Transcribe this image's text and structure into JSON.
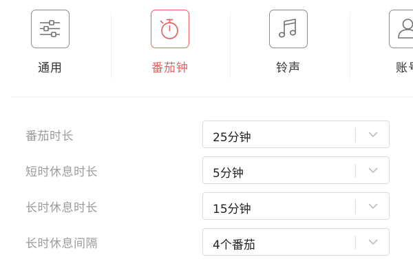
{
  "tabs": [
    {
      "id": "general",
      "label": "通用",
      "icon": "sliders-icon",
      "active": false
    },
    {
      "id": "pomodoro",
      "label": "番茄钟",
      "icon": "stopwatch-icon",
      "active": true
    },
    {
      "id": "ringtone",
      "label": "铃声",
      "icon": "music-note-icon",
      "active": false
    },
    {
      "id": "account",
      "label": "账号",
      "icon": "user-icon",
      "active": false
    }
  ],
  "colors": {
    "accent": "#e8605f",
    "icon_border": "#8a8a8a",
    "label_gray": "#9b9b9b",
    "text": "#222222"
  },
  "settings": [
    {
      "label": "番茄时长",
      "value": "25分钟"
    },
    {
      "label": "短时休息时长",
      "value": "5分钟"
    },
    {
      "label": "长时休息时长",
      "value": "15分钟"
    },
    {
      "label": "长时休息间隔",
      "value": "4个番茄"
    }
  ]
}
